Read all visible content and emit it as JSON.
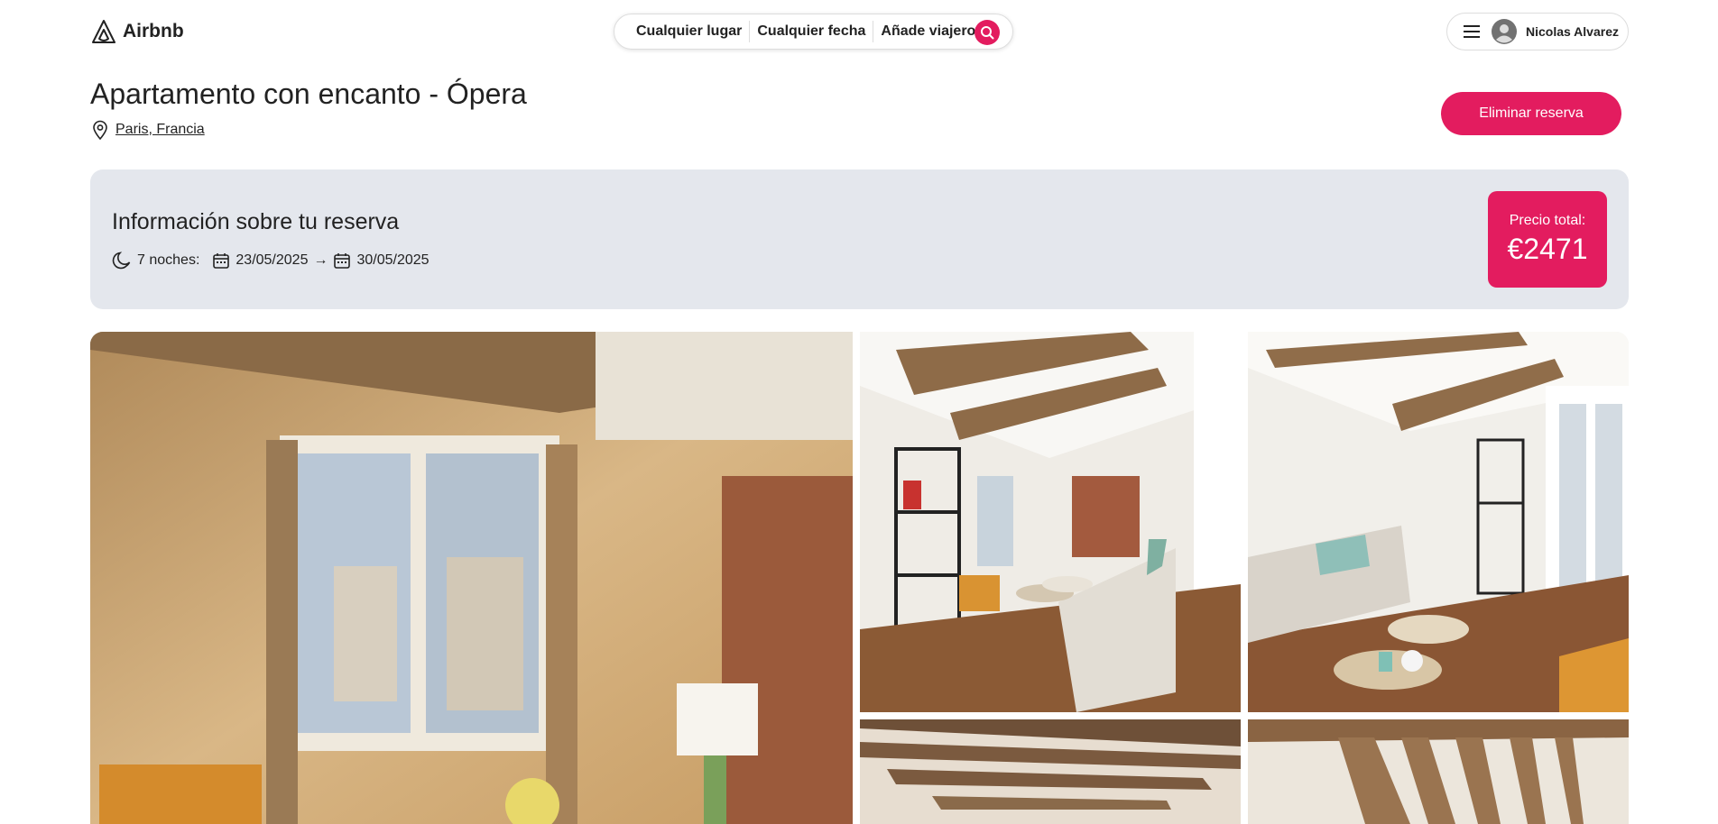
{
  "header": {
    "brand": "Airbnb",
    "search": {
      "location": "Cualquier lugar",
      "dates": "Cualquier fecha",
      "guests": "Añade viajeros"
    },
    "user_name": "Nicolas Alvarez"
  },
  "listing": {
    "title": "Apartamento con encanto - Ópera",
    "location": "Paris, Francia"
  },
  "actions": {
    "delete_label": "Eliminar reserva"
  },
  "booking": {
    "heading": "Información sobre tu reserva",
    "nights": "7 noches:",
    "check_in": "23/05/2025",
    "arrow": "→",
    "check_out": "30/05/2025",
    "price_label": "Precio total:",
    "price_value": "€2471"
  },
  "colors": {
    "accent": "#e31c5f",
    "panel": "#e4e7ed",
    "text": "#222222"
  },
  "icons": [
    "airbnb-logo-icon",
    "search-icon",
    "menu-icon",
    "avatar-icon",
    "map-pin-icon",
    "moon-icon",
    "calendar-icon"
  ]
}
